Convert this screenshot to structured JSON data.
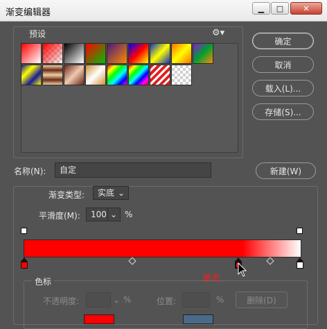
{
  "window": {
    "title": "渐变编辑器"
  },
  "presets": {
    "label": "预设"
  },
  "buttons": {
    "ok": "确定",
    "cancel": "取消",
    "load": "载入(L)...",
    "save": "存储(S)...",
    "new": "新建(W)",
    "delete": "删除(D)"
  },
  "name": {
    "label": "名称(N):",
    "value": "自定"
  },
  "gradient": {
    "type_label": "渐变类型:",
    "type_value": "实底",
    "smooth_label": "平滑度(M):",
    "smooth_value": "100",
    "smooth_unit": "%"
  },
  "color_stops": {
    "label": "色标",
    "opacity_label": "不透明度:",
    "opacity_unit": "%",
    "position_label": "位置:",
    "position_unit": "%"
  },
  "annotation": {
    "text": "单击"
  }
}
